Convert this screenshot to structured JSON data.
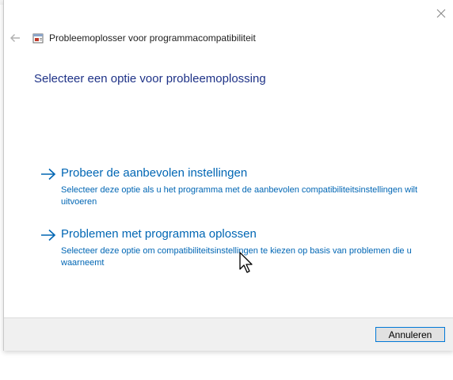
{
  "window": {
    "title": "Probleemoplosser voor programmacompatibiliteit",
    "close_icon": "close-icon",
    "back_icon": "back-arrow-icon",
    "app_icon": "troubleshooter-app-icon"
  },
  "main": {
    "heading": "Selecteer een optie voor probleemoplossing",
    "options": [
      {
        "icon": "arrow-right-icon",
        "title": "Probeer de aanbevolen instellingen",
        "description": "Selecteer deze optie als u het programma met de aanbevolen compatibiliteitsinstellingen wilt uitvoeren"
      },
      {
        "icon": "arrow-right-icon",
        "title": "Problemen met programma oplossen",
        "description": "Selecteer deze optie om compatibiliteitsinstellingen te kiezen op basis van problemen die u waarneemt"
      }
    ]
  },
  "footer": {
    "cancel_label": "Annuleren"
  },
  "colors": {
    "link": "#0066b4",
    "heading": "#1e3287",
    "footer_bg": "#f0f0f0",
    "button_border": "#0078d7"
  }
}
